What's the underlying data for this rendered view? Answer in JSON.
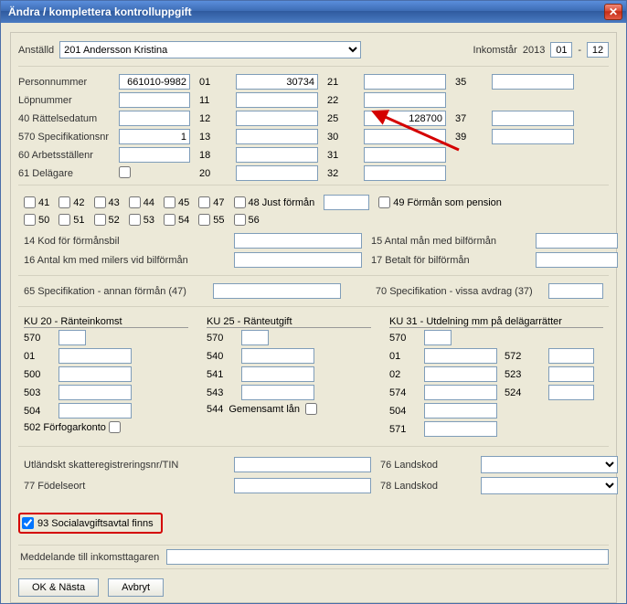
{
  "title": "Ändra / komplettera kontrolluppgift",
  "header": {
    "employee_label": "Anställd",
    "employee_code": "201",
    "employee_name": "Andersson Kristina",
    "income_year_label": "Inkomstår",
    "income_year": "2013",
    "month_from": "01",
    "month_sep": "-",
    "month_to": "12"
  },
  "left_labels": {
    "personnummer": "Personnummer",
    "lopnummer": "Löpnummer",
    "r40": "40 Rättelsedatum",
    "r570": "570 Specifikationsnr",
    "r60": "60 Arbetsställenr",
    "r61": "61 Delägare"
  },
  "left_values": {
    "personnummer": "661010-9982",
    "lopnummer": "",
    "r40": "",
    "r570": "1",
    "r60": "",
    "r61_checked": false
  },
  "cols": {
    "c1": [
      "01",
      "11",
      "12",
      "13",
      "18",
      "20"
    ],
    "c2": [
      "21",
      "22",
      "25",
      "30",
      "31",
      "32"
    ],
    "c3": [
      "35",
      "37",
      "39"
    ]
  },
  "col_vals": {
    "c1": [
      "30734",
      "",
      "",
      "",
      "",
      ""
    ],
    "c2": [
      "",
      "",
      "128700",
      "",
      "",
      ""
    ],
    "c3": [
      "",
      "",
      ""
    ]
  },
  "checks": {
    "nums": [
      "41",
      "42",
      "43",
      "44",
      "45",
      "47"
    ],
    "just_forman": "48 Just förmån",
    "pension": "49 Förmån som pension",
    "nums2": [
      "50",
      "51",
      "52",
      "53",
      "54",
      "55",
      "56"
    ]
  },
  "mid": {
    "r14": "14 Kod för förmånsbil",
    "r15": "15 Antal mån med bilförmån",
    "r16": "16 Antal km med milers vid bilförmån",
    "r17": "17 Betalt för bilförmån"
  },
  "spec": {
    "s65": "65  Specifikation - annan förmån (47)",
    "s70": "70  Specifikation - vissa avdrag (37)"
  },
  "ku20": {
    "title": "KU 20 - Ränteinkomst",
    "rows": [
      "570",
      "01",
      "500",
      "503",
      "504"
    ],
    "r502": "502 Förfogarkonto"
  },
  "ku25": {
    "title": "KU 25 - Ränteutgift",
    "rows": [
      "570",
      "540",
      "541",
      "543"
    ],
    "r544": "544",
    "r544_label": "Gemensamt lån"
  },
  "ku31": {
    "title": "KU 31 - Utdelning mm på delägarrätter",
    "left": [
      "570",
      "01",
      "02",
      "574",
      "504",
      "571"
    ],
    "right": [
      "572",
      "523",
      "524"
    ]
  },
  "lower": {
    "tin": "Utländskt skatteregistreringsnr/TIN",
    "fodelseort": "77  Födelseort",
    "land76": "76  Landskod",
    "land78": "78  Landskod"
  },
  "check93": "93 Socialavgiftsavtal finns",
  "check93_checked": true,
  "msg_label": "Meddelande till inkomsttagaren",
  "btn_ok": "OK & Nästa",
  "btn_cancel": "Avbryt"
}
